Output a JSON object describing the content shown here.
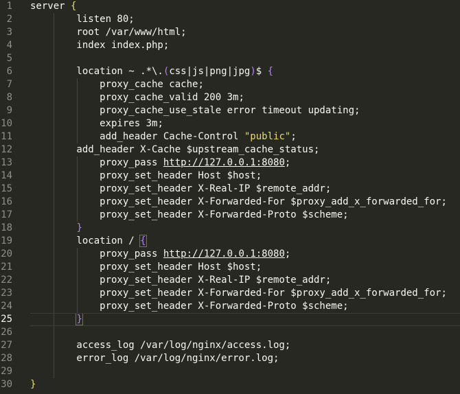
{
  "editor": {
    "language": "nginx",
    "current_line": 25,
    "lines": [
      {
        "n": "1",
        "parts": [
          [
            "server ",
            ""
          ],
          [
            "{",
            "brace"
          ]
        ]
      },
      {
        "n": "2",
        "parts": [
          [
            "        listen 80",
            ""
          ],
          [
            ";",
            "punc"
          ]
        ]
      },
      {
        "n": "3",
        "parts": [
          [
            "        root /var/www/html",
            ""
          ],
          [
            ";",
            "punc"
          ]
        ]
      },
      {
        "n": "4",
        "parts": [
          [
            "        index index.php",
            ""
          ],
          [
            ";",
            "punc"
          ]
        ]
      },
      {
        "n": "5",
        "parts": []
      },
      {
        "n": "6",
        "parts": [
          [
            "        location ~ .*\\.",
            ""
          ],
          [
            "(",
            "brace-p"
          ],
          [
            "css|js|png|jpg",
            ""
          ],
          [
            ")",
            "brace-p"
          ],
          [
            "$ ",
            ""
          ],
          [
            "{",
            "brace-p"
          ]
        ]
      },
      {
        "n": "7",
        "parts": [
          [
            "            proxy_cache cache",
            ""
          ],
          [
            ";",
            "punc"
          ]
        ]
      },
      {
        "n": "8",
        "parts": [
          [
            "            proxy_cache_valid 200 3m",
            ""
          ],
          [
            ";",
            "punc"
          ]
        ]
      },
      {
        "n": "9",
        "parts": [
          [
            "            proxy_cache_use_stale error timeout updating",
            ""
          ],
          [
            ";",
            "punc"
          ]
        ]
      },
      {
        "n": "10",
        "parts": [
          [
            "            expires 3m",
            ""
          ],
          [
            ";",
            "punc"
          ]
        ]
      },
      {
        "n": "11",
        "parts": [
          [
            "            add_header Cache-Control ",
            ""
          ],
          [
            "\"public\"",
            "str"
          ],
          [
            ";",
            "punc"
          ]
        ]
      },
      {
        "n": "12",
        "parts": [
          [
            "        add_header X-Cache $upstream_cache_status",
            ""
          ],
          [
            ";",
            "punc"
          ]
        ]
      },
      {
        "n": "13",
        "parts": [
          [
            "            proxy_pass ",
            ""
          ],
          [
            "http://127.0.0.1:8080",
            "url"
          ],
          [
            ";",
            "punc"
          ]
        ]
      },
      {
        "n": "14",
        "parts": [
          [
            "            proxy_set_header Host $host",
            ""
          ],
          [
            ";",
            "punc"
          ]
        ]
      },
      {
        "n": "15",
        "parts": [
          [
            "            proxy_set_header X-Real-IP $remote_addr",
            ""
          ],
          [
            ";",
            "punc"
          ]
        ]
      },
      {
        "n": "16",
        "parts": [
          [
            "            proxy_set_header X-Forwarded-For $proxy_add_x_forwarded_for",
            ""
          ],
          [
            ";",
            "punc"
          ]
        ]
      },
      {
        "n": "17",
        "parts": [
          [
            "            proxy_set_header X-Forwarded-Proto $scheme",
            ""
          ],
          [
            ";",
            "punc"
          ]
        ]
      },
      {
        "n": "18",
        "parts": [
          [
            "        ",
            ""
          ],
          [
            "}",
            "brace-p"
          ]
        ]
      },
      {
        "n": "19",
        "parts": [
          [
            "        location / ",
            ""
          ],
          [
            "{",
            "brace-p bm"
          ]
        ]
      },
      {
        "n": "20",
        "parts": [
          [
            "            proxy_pass ",
            ""
          ],
          [
            "http://127.0.0.1:8080",
            "url"
          ],
          [
            ";",
            "punc"
          ]
        ]
      },
      {
        "n": "21",
        "parts": [
          [
            "            proxy_set_header Host $host",
            ""
          ],
          [
            ";",
            "punc"
          ]
        ]
      },
      {
        "n": "22",
        "parts": [
          [
            "            proxy_set_header X-Real-IP $remote_addr",
            ""
          ],
          [
            ";",
            "punc"
          ]
        ]
      },
      {
        "n": "23",
        "parts": [
          [
            "            proxy_set_header X-Forwarded-For $proxy_add_x_forwarded_for",
            ""
          ],
          [
            ";",
            "punc"
          ]
        ]
      },
      {
        "n": "24",
        "parts": [
          [
            "            proxy_set_header X-Forwarded-Proto $scheme",
            ""
          ],
          [
            ";",
            "punc"
          ]
        ]
      },
      {
        "n": "25",
        "parts": [
          [
            "        ",
            ""
          ],
          [
            "}",
            "brace-p bm"
          ]
        ]
      },
      {
        "n": "26",
        "parts": []
      },
      {
        "n": "27",
        "parts": [
          [
            "        access_log /var/log/nginx/access.log",
            ""
          ],
          [
            ";",
            "punc"
          ]
        ]
      },
      {
        "n": "28",
        "parts": [
          [
            "        error_log /var/log/nginx/error.log",
            ""
          ],
          [
            ";",
            "punc"
          ]
        ]
      },
      {
        "n": "29",
        "parts": []
      },
      {
        "n": "30",
        "parts": [
          [
            "",
            ""
          ],
          [
            "}",
            "brace"
          ]
        ]
      }
    ]
  },
  "colors": {
    "background": "#272822",
    "text": "#f8f8f2",
    "gutter_text": "#90908a",
    "string": "#e6db74",
    "bracket": "#ae81ff",
    "indent_guide": "#464741",
    "current_line_border": "#3e3d32"
  }
}
